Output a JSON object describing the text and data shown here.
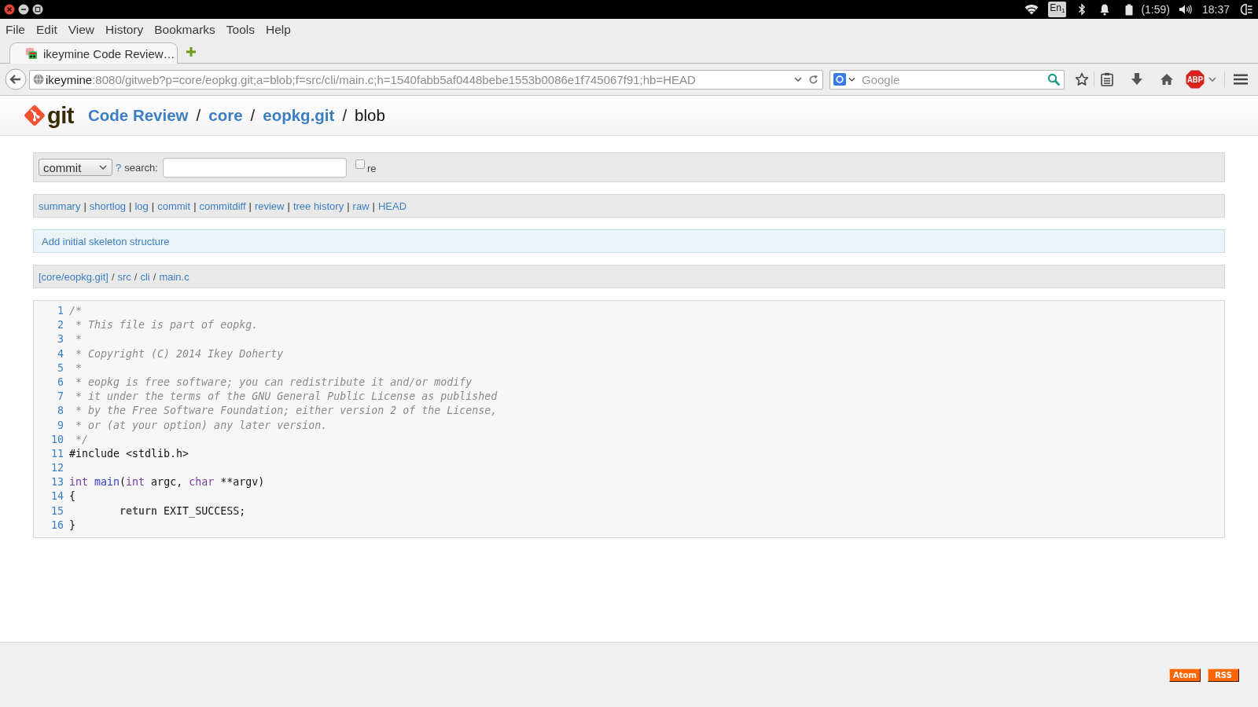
{
  "system_bar": {
    "keyboard_layout": "En$_{1}$",
    "battery_time": "(1:59)",
    "clock": "18:37"
  },
  "menu_bar": [
    {
      "label": "File"
    },
    {
      "label": "Edit"
    },
    {
      "label": "View"
    },
    {
      "label": "History"
    },
    {
      "label": "Bookmarks"
    },
    {
      "label": "Tools"
    },
    {
      "label": "Help"
    }
  ],
  "tabs": [
    {
      "title": "ikeymine Code Review…",
      "selected": true
    }
  ],
  "address_bar": {
    "host": "ikeymine",
    "path": ":8080/gitweb?p=core/eopkg.git;a=blob;f=src/cli/main.c;h=1540fabb5af0448bebe1553b0086e1f745067f91;hb=HEAD"
  },
  "search_box": {
    "placeholder": "Google"
  },
  "toolbar": {
    "adblock_label": "ABP"
  },
  "page_header": {
    "logo": "git",
    "separator": "/",
    "breadcrumbs": [
      {
        "label": "Code Review",
        "kind": "link"
      },
      {
        "label": "core",
        "kind": "link"
      },
      {
        "label": "eopkg.git",
        "kind": "link"
      },
      {
        "label": "blob",
        "kind": "current"
      }
    ]
  },
  "search_form": {
    "type": "commit",
    "help": "?",
    "label": "search:",
    "regex": {
      "label": "re",
      "checked": false
    }
  },
  "nav_links": {
    "separator": "|",
    "items": [
      "summary",
      "shortlog",
      "log",
      "commit",
      "commitdiff",
      "review",
      "tree history",
      "raw",
      "HEAD"
    ]
  },
  "commit_title": "Add initial skeleton structure",
  "path": {
    "separator": "/",
    "items": [
      "[core/eopkg.git]",
      "src",
      "cli",
      "main.c"
    ]
  },
  "code": {
    "lines": [
      {
        "number": "1",
        "tokens": [
          {
            "kind": "comment",
            "text": "/*"
          }
        ]
      },
      {
        "number": "2",
        "tokens": [
          {
            "kind": "comment",
            "text": " * This file is part of eopkg."
          }
        ]
      },
      {
        "number": "3",
        "tokens": [
          {
            "kind": "comment",
            "text": " *"
          }
        ]
      },
      {
        "number": "4",
        "tokens": [
          {
            "kind": "comment",
            "text": " * Copyright (C) 2014 Ikey Doherty"
          }
        ]
      },
      {
        "number": "5",
        "tokens": [
          {
            "kind": "comment",
            "text": " *"
          }
        ]
      },
      {
        "number": "6",
        "tokens": [
          {
            "kind": "comment",
            "text": " * eopkg is free software; you can redistribute it and/or modify"
          }
        ]
      },
      {
        "number": "7",
        "tokens": [
          {
            "kind": "comment",
            "text": " * it under the terms of the GNU General Public License as published"
          }
        ]
      },
      {
        "number": "8",
        "tokens": [
          {
            "kind": "comment",
            "text": " * by the Free Software Foundation; either version 2 of the License,"
          }
        ]
      },
      {
        "number": "9",
        "tokens": [
          {
            "kind": "comment",
            "text": " * or (at your option) any later version."
          }
        ]
      },
      {
        "number": "10",
        "tokens": [
          {
            "kind": "comment",
            "text": " */"
          }
        ]
      },
      {
        "number": "11",
        "tokens": [
          {
            "kind": "plain",
            "text": "#include <stdlib.h>"
          }
        ]
      },
      {
        "number": "12"
      },
      {
        "number": "13",
        "tokens": [
          {
            "kind": "type",
            "text": "int"
          },
          {
            "kind": "function",
            "text": " main"
          },
          {
            "kind": "plain",
            "text": "("
          },
          {
            "kind": "type",
            "text": "int"
          },
          {
            "kind": "plain",
            "text": " argc, "
          },
          {
            "kind": "type",
            "text": "char"
          },
          {
            "kind": "plain",
            "text": " **argv)"
          }
        ]
      },
      {
        "number": "14",
        "tokens": [
          {
            "kind": "plain",
            "text": "{"
          }
        ]
      },
      {
        "number": "15",
        "tokens": [
          {
            "kind": "keyword",
            "text": "\treturn"
          },
          {
            "kind": "plain",
            "text": " EXIT_SUCCESS;"
          }
        ]
      },
      {
        "number": "16",
        "tokens": [
          {
            "kind": "plain",
            "text": "}"
          }
        ]
      }
    ]
  },
  "footer": {
    "feeds": [
      {
        "label": "Atom"
      },
      {
        "label": "RSS"
      }
    ]
  }
}
